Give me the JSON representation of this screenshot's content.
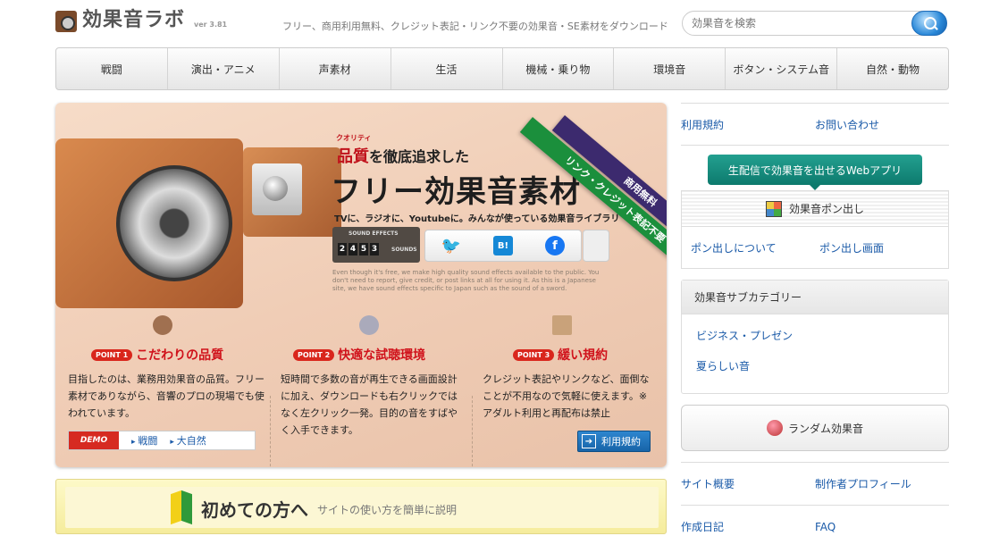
{
  "header": {
    "logo_text": "効果音ラボ",
    "version": "ver 3.81",
    "tagline": "フリー、商用利用無料、クレジット表記・リンク不要の効果音・SE素材をダウンロード",
    "search_placeholder": "効果音を検索"
  },
  "nav": [
    "戦闘",
    "演出・アニメ",
    "声素材",
    "生活",
    "機械・乗り物",
    "環境音",
    "ボタン・システム音",
    "自然・動物"
  ],
  "hero": {
    "ruby": "クオリティ",
    "quality_emph": "品質",
    "quality_rest": "を徹底追求した",
    "title": "フリー効果音素材",
    "subtitle": "TVに、ラジオに、Youtubeに。みんなが使っている効果音ライブラリ",
    "counter_label": "SOUND EFFECTS",
    "counter_digits": [
      "2",
      "4",
      "5",
      "3"
    ],
    "counter_unit": "SOUNDS",
    "share_hatena": "B!",
    "share_facebook": "f",
    "english_blurb": "Even though it's free, we make high quality sound effects available to the public. You don't need to report, give credit, or post links at all for using it. As this is a Japanese site, we have sound effects specific to Japan such as the sound of a sword.",
    "ribbon_commercial": "商用無料",
    "ribbon_credit": "リンク・クレジット表記不要",
    "points": [
      {
        "badge": "POINT 1",
        "title": "こだわりの品質",
        "body": "目指したのは、業務用効果音の品質。フリー素材でありながら、音響のプロの現場でも使われています。"
      },
      {
        "badge": "POINT 2",
        "title": "快適な試聴環境",
        "body": "短時間で多数の音が再生できる画面設計に加え、ダウンロードも右クリックではなく左クリック一発。目的の音をすばやく入手できます。"
      },
      {
        "badge": "POINT 3",
        "title": "緩い規約",
        "body": "クレジット表記やリンクなど、面倒なことが不用なので気軽に使えます。※アダルト利用と再配布は禁止"
      }
    ],
    "demo_badge": "DEMO",
    "demo_links": [
      "戦闘",
      "大自然"
    ],
    "terms_button": "利用規約"
  },
  "banner": {
    "title": "初めての方へ",
    "subtitle": "サイトの使い方を簡単に説明"
  },
  "sidebar": {
    "top_links": [
      "利用規約",
      "お問い合わせ"
    ],
    "pon_button": "生配信で効果音を出せるWebアプリ",
    "pon_title": "効果音ポン出し",
    "pon_links": [
      "ポン出しについて",
      "ポン出し画面"
    ],
    "category_title": "効果音サブカテゴリー",
    "categories": [
      "ビジネス・プレゼン",
      "夏らしい音"
    ],
    "random_button": "ランダム効果音",
    "footer_links": [
      [
        "サイト概要",
        "制作者プロフィール"
      ],
      [
        "作成日記",
        "FAQ"
      ]
    ]
  },
  "colors": {
    "accent_red": "#d0121b",
    "link_blue": "#1a5aa8",
    "teal": "#0d7a6d",
    "ribbon_green": "#1b8f3c",
    "ribbon_purple": "#3c2a6e"
  }
}
